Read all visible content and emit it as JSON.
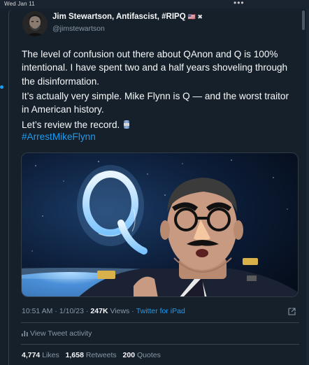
{
  "system": {
    "date": "Wed Jan 11",
    "dots": "•••"
  },
  "tweet": {
    "author_name": "Jim Stewartson, Antifascist, #RIPQ",
    "author_flags": "🇺🇸 ✖",
    "handle": "@jimstewartson",
    "paragraph1": "The level of confusion out there about QAnon and Q is 100% intentional. I have spent two and a half years shoveling through the disinformation.",
    "paragraph2": "It’s actually very simple. Mike Flynn is Q — and the worst traitor in American history.",
    "paragraph3": "Let’s review the record.",
    "hashtag": "#ArrestMikeFlynn",
    "time": "10:51 AM",
    "date": "1/10/23",
    "views_count": "247K",
    "views_label": "Views",
    "source": "Twitter for iPad",
    "activity_label": "View Tweet activity",
    "likes_count": "4,774",
    "likes_label": "Likes",
    "retweets_count": "1,658",
    "retweets_label": "Retweets",
    "quotes_count": "200",
    "quotes_label": "Quotes"
  },
  "colors": {
    "background": "#15202b",
    "accent": "#1d9bf0",
    "secondary_text": "#8b98a5",
    "border": "#38444d"
  }
}
